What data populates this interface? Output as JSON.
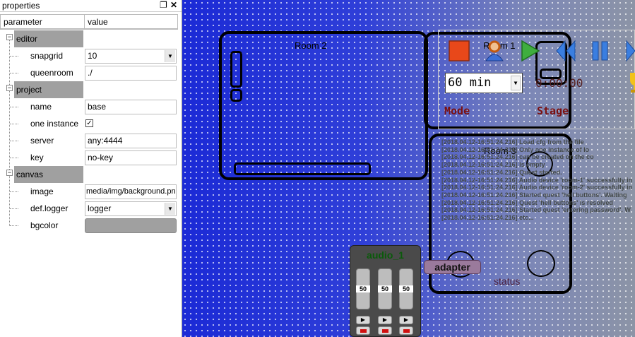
{
  "properties": {
    "title": "properties",
    "float_icon": "float-window-icon",
    "close_icon": "close-icon",
    "columns": {
      "parameter": "parameter",
      "value": "value"
    },
    "groups": {
      "editor": "editor",
      "project": "project",
      "canvas": "canvas"
    },
    "editor": {
      "snapgrid_label": "snapgrid",
      "snapgrid_value": "10",
      "queenroom_label": "queenroom",
      "queenroom_value": "./"
    },
    "project": {
      "name_label": "name",
      "name_value": "base",
      "one_instance_label": "one instance",
      "one_instance_checked": true,
      "server_label": "server",
      "server_value": "any:4444",
      "key_label": "key",
      "key_value": "no-key"
    },
    "canvas": {
      "image_label": "image",
      "image_value": "media/img/background.png",
      "def_logger_label": "def.logger",
      "def_logger_value": "logger",
      "bgcolor_label": "bgcolor",
      "bgcolor_value": "#a0a0a0"
    }
  },
  "scene": {
    "room2_title": "Room 2",
    "room1_title": "Room 1",
    "room3_title": "Room 3",
    "minutes": "60 min",
    "timer": "0:00:00",
    "mode_label": "Mode",
    "stage_label": "Stage",
    "adapter_label": "adapter",
    "status_label": "status",
    "log_lines": [
      "[2018.04.12-16:51:24.216] Load cfg from the file",
      "[2018.04.12-16:51:24.216] Only one instance of lo",
      "[2018.04.12-16:51:24.216] can be created on the co",
      "[2018.04.12-16:51:24.216] Is empty",
      "[2018.04.12-16:51:24.216] Quest started.",
      "[2018.04.12-16:51:24.216] Audio device 'room-1' successfully in",
      "[2018.04.12-16:51:24.216] Audio device 'room-2' successfully in",
      "[2018.04.12-16:51:24.216] Started quest 'hell buttons'. Waiting",
      "[2018.04.12-16:51:24.216] Quest 'hell buttons' is resolved",
      "[2018.04.12-16:51:24.216] Started quest 'entering password'. W",
      "[2018.04.12-16:51:24.216] etc..."
    ],
    "toolbar_icons": [
      "stop-icon",
      "person-icon",
      "play-icon",
      "rewind-icon",
      "pause-icon",
      "forward-icon",
      "trophy-icon"
    ],
    "audio": {
      "title": "audio_1",
      "channels": [
        "50",
        "50",
        "50"
      ]
    },
    "colors": {
      "canvas_blue": "#1a2bd6",
      "log_text": "#444a4a",
      "mode_text": "#7a1010",
      "adapter_bg": "#9a7a9c",
      "audio_title": "#0a5a0a"
    }
  }
}
